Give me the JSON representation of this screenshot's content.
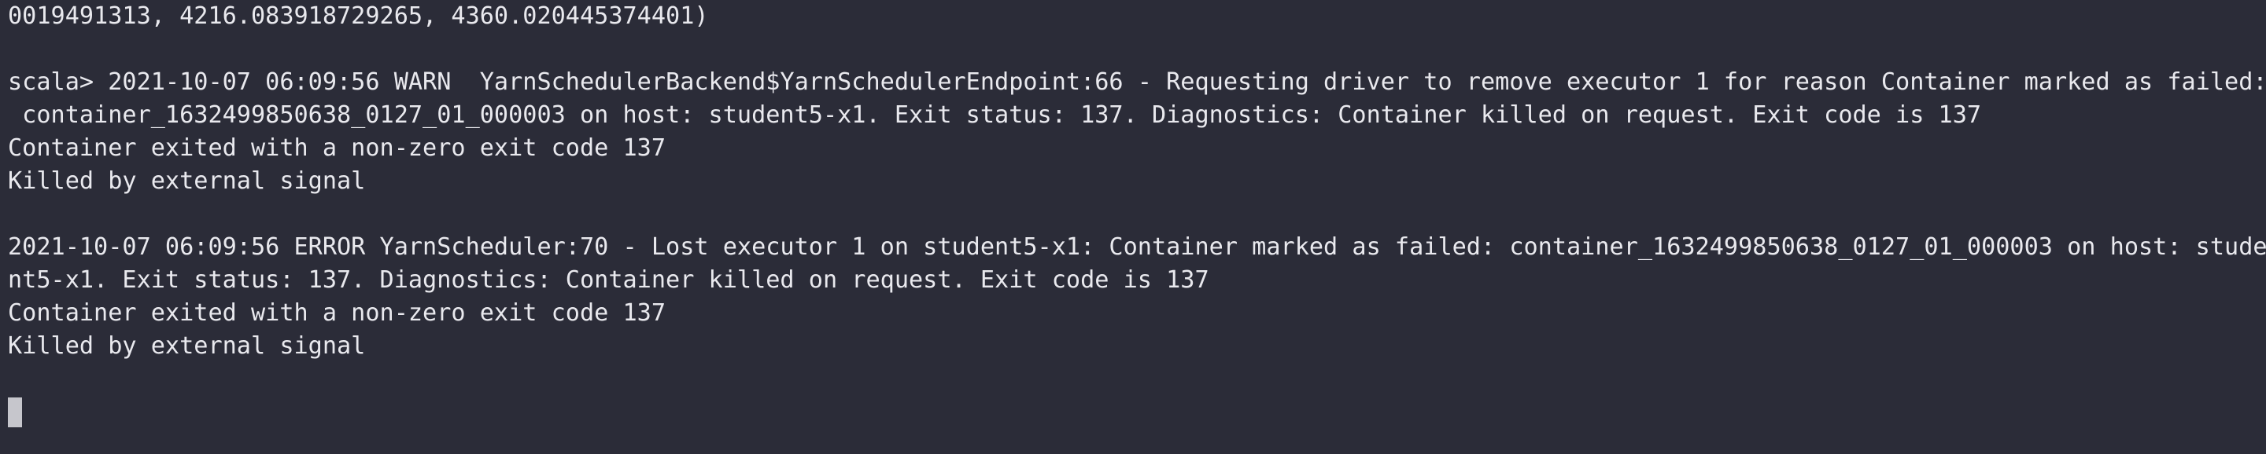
{
  "terminal": {
    "lines": [
      "0019491313, 4216.083918729265, 4360.020445374401)",
      "",
      "scala> 2021-10-07 06:09:56 WARN  YarnSchedulerBackend$YarnSchedulerEndpoint:66 - Requesting driver to remove executor 1 for reason Container marked as failed:",
      " container_1632499850638_0127_01_000003 on host: student5-x1. Exit status: 137. Diagnostics: Container killed on request. Exit code is 137",
      "Container exited with a non-zero exit code 137",
      "Killed by external signal",
      "",
      "2021-10-07 06:09:56 ERROR YarnScheduler:70 - Lost executor 1 on student5-x1: Container marked as failed: container_1632499850638_0127_01_000003 on host: stude",
      "nt5-x1. Exit status: 137. Diagnostics: Container killed on request. Exit code is 137",
      "Container exited with a non-zero exit code 137",
      "Killed by external signal"
    ]
  }
}
